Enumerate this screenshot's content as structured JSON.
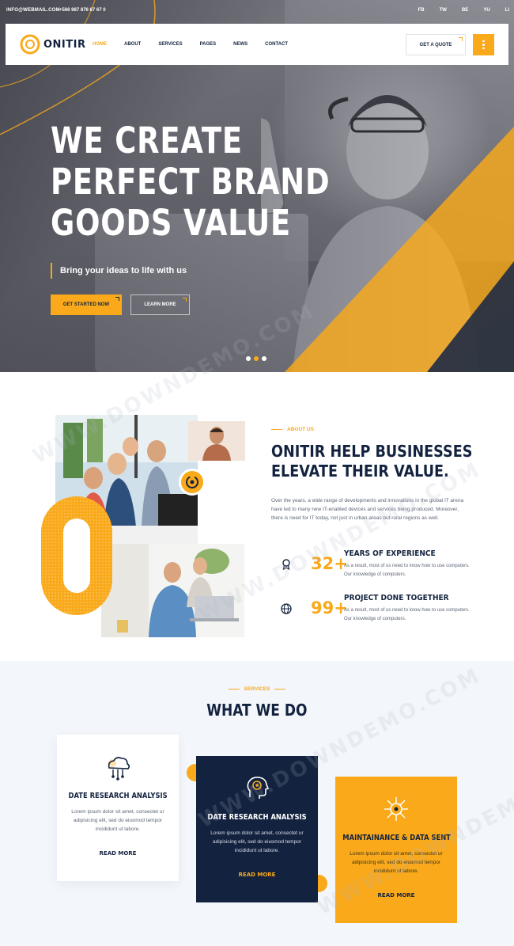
{
  "topbar": {
    "email": "INFO@WEBMAIL.COM",
    "phone": "+566 987 876 67 67 0",
    "socials": [
      "FB",
      "TW",
      "BE",
      "YU",
      "LI"
    ]
  },
  "brand": {
    "name": "ONITIR",
    "accent": "#f9a91a",
    "dark": "#13233f"
  },
  "nav": {
    "items": [
      {
        "label": "HOME",
        "active": true
      },
      {
        "label": "ABOUT"
      },
      {
        "label": "SERVICES"
      },
      {
        "label": "PAGES"
      },
      {
        "label": "NEWS"
      },
      {
        "label": "CONTACT"
      }
    ],
    "quote_label": "GET A QUOTE",
    "menu_icon": "dots-vertical-icon"
  },
  "hero": {
    "title_lines": [
      "WE CREATE",
      "PERFECT BRAND",
      "GOODS VALUE"
    ],
    "subtitle": "Bring your ideas to life with us",
    "primary_cta": "GET STARTED NOW",
    "secondary_cta": "LEARN MORE",
    "slides": 3,
    "active_slide": 2
  },
  "about": {
    "eyebrow": "ABOUT US",
    "title_lines": [
      "ONITIR HELP BUSINESSES",
      "ELEVATE THEIR VALUE."
    ],
    "text": "Over the years, a wide range of developments and innovations in the global IT arena have led to many new IT-enabled devices and services being produced. Moreover, there is need for IT today, not just in urban areas but rural regions as well.",
    "stats": [
      {
        "icon": "award-icon",
        "number": "32+",
        "title": "YEARS OF EXPERIENCE",
        "desc": "As a result, most of us need to know how to use computers. Our knowledge of computers."
      },
      {
        "icon": "globe-icon",
        "number": "99+",
        "title": "PROJECT DONE TOGETHER",
        "desc": "As a result, most of us need to know how to use computers. Our knowledge of computers."
      }
    ]
  },
  "services": {
    "eyebrow": "SERVICES",
    "title": "WHAT WE DO",
    "cards": [
      {
        "icon": "cloud-network-icon",
        "title": "DATE RESEARCH ANALYSIS",
        "text": "Lorem ipsum dolor sit amet, consectet ur adipisicing elit, sed do eiusmod tempor incididunt ut labore.",
        "link": "READ MORE"
      },
      {
        "icon": "brain-gear-icon",
        "title": "DATE RESEARCH ANALYSIS",
        "text": "Lorem ipsum dolor sit amet, consectet ur adipisicing elit, sed do eiusmod tempor incididunt ut labore.",
        "link": "READ MORE"
      },
      {
        "icon": "network-hub-icon",
        "title": "MAINTAINANCE & DATA SENT",
        "text": "Lorem ipsum dolor sit amet, consectet ur adipisicing elit, sed do eiusmod tempor incididunt ut labore.",
        "link": "READ MORE"
      }
    ]
  },
  "watermark": "WWW.DOWNDEMO.COM"
}
